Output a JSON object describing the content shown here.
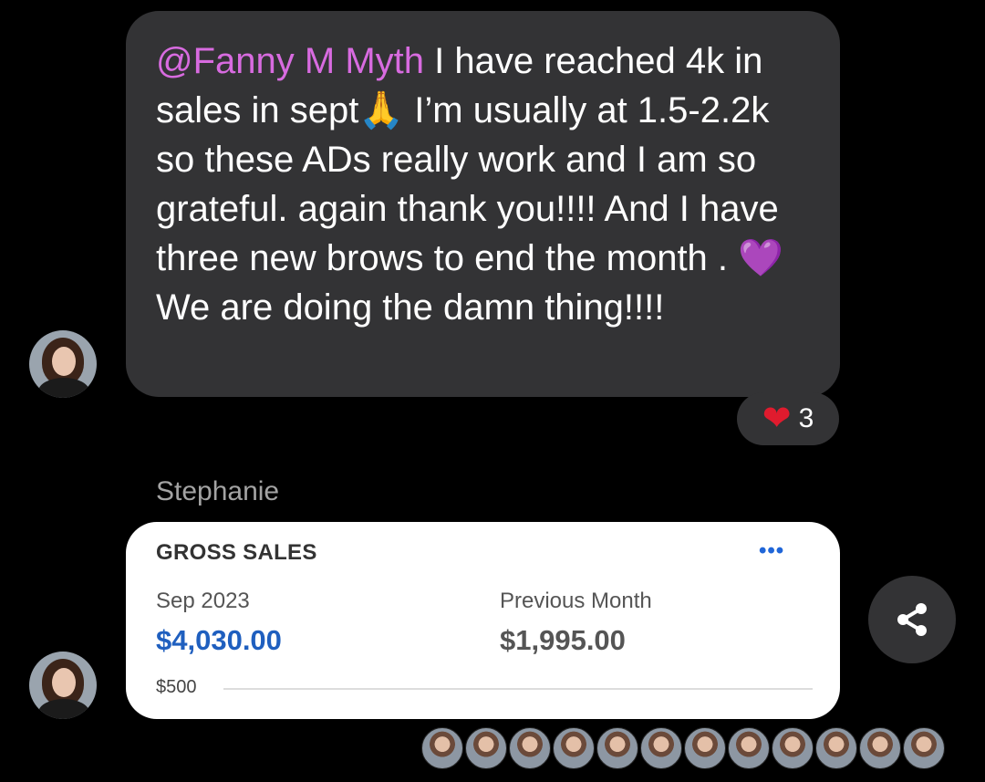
{
  "message": {
    "mention": "@Fanny M Myth",
    "text_part1": " I have reached 4k in sales in sept",
    "emoji_pray": "🙏",
    "text_part2": " I’m usually at 1.5-2.2k so these ADs really work and I am so grateful. again thank you!!!! And I have three new brows to end the month . ",
    "emoji_heart": "💜",
    "text_part3": "We are doing the damn thing!!!!",
    "reaction_icon": "red-heart",
    "reaction_count": "3"
  },
  "second_message": {
    "sender": "Stephanie",
    "card": {
      "title": "GROSS SALES",
      "more": "•••",
      "current_label": "Sep 2023",
      "current_value": "$4,030.00",
      "previous_label": "Previous Month",
      "previous_value": "$1,995.00",
      "axis_label": "$500"
    }
  },
  "share_icon": "share-icon",
  "seen_by_count": 12,
  "colors": {
    "background": "#000000",
    "bubble": "#333335",
    "mention": "#d86be0",
    "card_value_current": "#1f5fbf",
    "more_dots": "#2066d8"
  }
}
